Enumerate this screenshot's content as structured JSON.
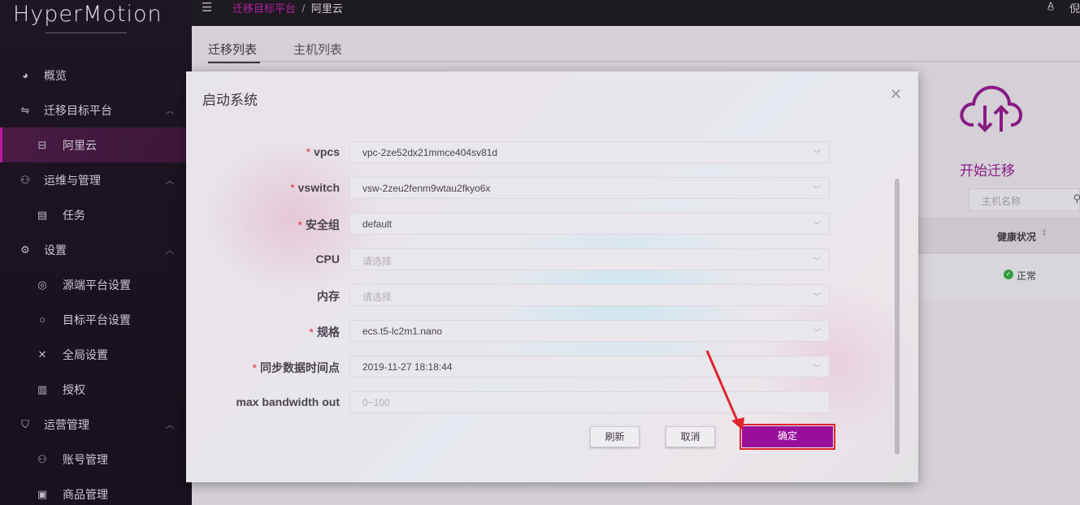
{
  "app": {
    "logo": "HyperMotion"
  },
  "sidebar": {
    "items": [
      {
        "label": "概览",
        "icon": "dashboard-icon",
        "glyph": "◕"
      },
      {
        "label": "迁移目标平台",
        "icon": "swap-icon",
        "glyph": "⇋",
        "expanded": true
      },
      {
        "label": "阿里云",
        "icon": "folder-icon",
        "glyph": "⊟",
        "active": true
      },
      {
        "label": "运维与管理",
        "icon": "user-icon",
        "glyph": "⚇",
        "expanded": true
      },
      {
        "label": "任务",
        "icon": "list-icon",
        "glyph": "▤"
      },
      {
        "label": "设置",
        "icon": "gear-icon",
        "glyph": "⚙",
        "expanded": true
      },
      {
        "label": "源端平台设置",
        "icon": "target-icon",
        "glyph": "◎"
      },
      {
        "label": "目标平台设置",
        "icon": "circle-icon",
        "glyph": "○"
      },
      {
        "label": "全局设置",
        "icon": "tools-icon",
        "glyph": "✕"
      },
      {
        "label": "授权",
        "icon": "barcode-icon",
        "glyph": "▥"
      },
      {
        "label": "运营管理",
        "icon": "shield-icon",
        "glyph": "⛉",
        "expanded": true
      },
      {
        "label": "账号管理",
        "icon": "account-icon",
        "glyph": "⚇"
      },
      {
        "label": "商品管理",
        "icon": "goods-icon",
        "glyph": "▣"
      }
    ]
  },
  "header": {
    "breadcrumb_1": "迁移目标平台",
    "breadcrumb_sep": "/",
    "breadcrumb_2": "阿里云",
    "user": "倪"
  },
  "main": {
    "tabs": [
      {
        "label": "迁移列表"
      },
      {
        "label": "主机列表"
      }
    ],
    "start_migrate": "开始迁移",
    "search_placeholder": "主机名称",
    "table_header": "健康状况",
    "table_status": "正常"
  },
  "modal": {
    "title": "启动系统",
    "fields": [
      {
        "label": "vpcs",
        "required": true,
        "value": "vpc-2ze52dx21mmce404sv81d",
        "placeholder": false,
        "dropdown": true
      },
      {
        "label": "vswitch",
        "required": true,
        "value": "vsw-2zeu2fenm9wtau2fkyo6x",
        "placeholder": false,
        "dropdown": true
      },
      {
        "label": "安全组",
        "required": true,
        "value": "default",
        "placeholder": false,
        "dropdown": true
      },
      {
        "label": "CPU",
        "required": false,
        "value": "请选择",
        "placeholder": true,
        "dropdown": true
      },
      {
        "label": "内存",
        "required": false,
        "value": "请选择",
        "placeholder": true,
        "dropdown": true
      },
      {
        "label": "规格",
        "required": true,
        "value": "ecs.t5-lc2m1.nano",
        "placeholder": false,
        "dropdown": true
      },
      {
        "label": "同步数据时间点",
        "required": true,
        "value": "2019-11-27 18:18:44",
        "placeholder": false,
        "dropdown": true
      },
      {
        "label": "max bandwidth out",
        "required": false,
        "value": "0~100",
        "placeholder": true,
        "dropdown": false
      }
    ],
    "refresh_label": "刷新",
    "cancel_label": "取消",
    "ok_label": "确定",
    "accent_color": "#9a0f9a"
  }
}
